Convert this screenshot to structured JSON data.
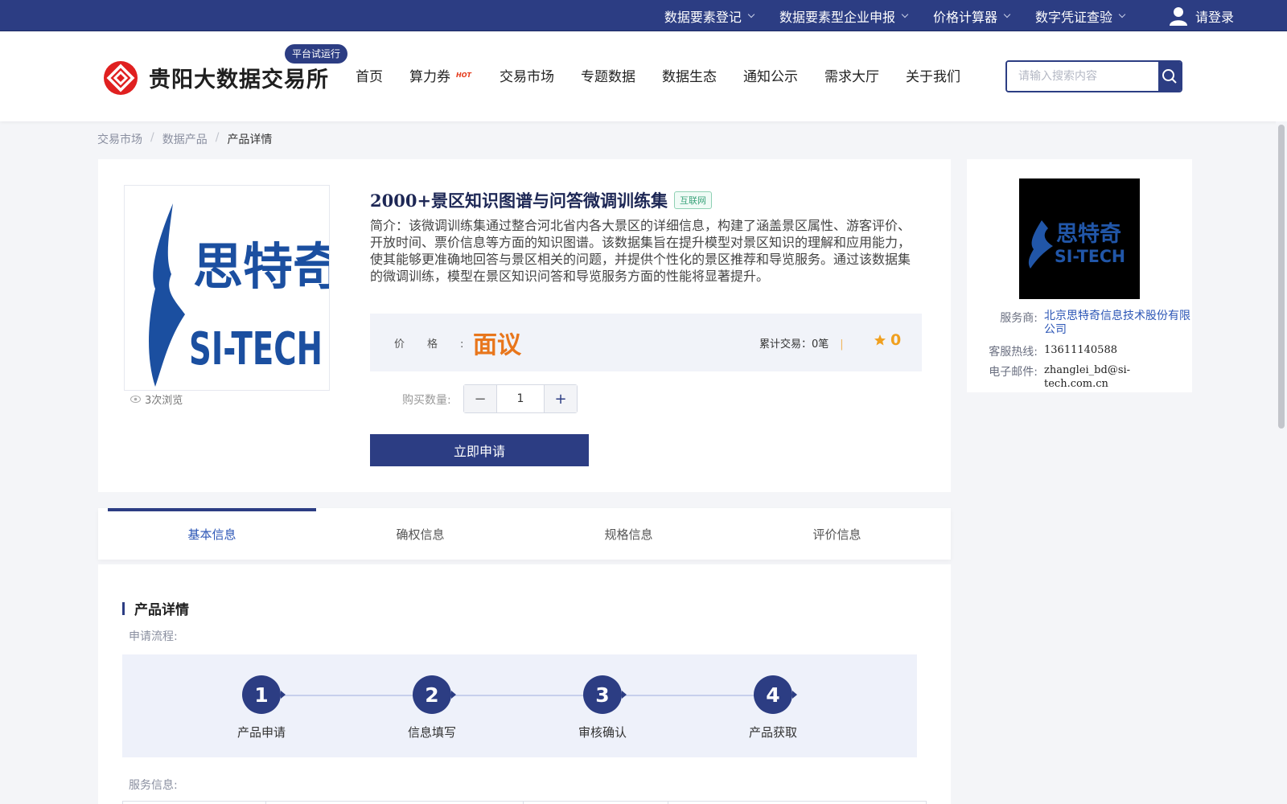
{
  "topbar": {
    "items": [
      {
        "label": "数据要素登记"
      },
      {
        "label": "数据要素型企业申报"
      },
      {
        "label": "价格计算器"
      },
      {
        "label": "数字凭证查验"
      }
    ],
    "login_label": "请登录"
  },
  "header": {
    "site_name": "贵阳大数据交易所",
    "badge": "平台试运行",
    "nav": [
      {
        "label": "首页"
      },
      {
        "label": "算力券",
        "tag": "HOT"
      },
      {
        "label": "交易市场"
      },
      {
        "label": "专题数据"
      },
      {
        "label": "数据生态"
      },
      {
        "label": "通知公示"
      },
      {
        "label": "需求大厅"
      },
      {
        "label": "关于我们"
      }
    ],
    "search_placeholder": "请输入搜索内容"
  },
  "breadcrumb": [
    "交易市场",
    "数据产品",
    "产品详情"
  ],
  "product": {
    "title": "2000+景区知识图谱与问答微调训练集",
    "tag": "互联网",
    "description": "简介：该微调训练集通过整合河北省内各大景区的详细信息，构建了涵盖景区属性、游客评价、开放时间、票价信息等方面的知识图谱。该数据集旨在提升模型对景区知识的理解和应用能力，使其能够更准确地回答与景区相关的问题，并提供个性化的景区推荐和导览服务。通过该数据集的微调训练，模型在景区知识问答和导览服务方面的性能将显著提升。",
    "image_text_cn": "思特奇",
    "image_text_en": "SI-TECH",
    "views": "3次浏览",
    "price_label": "价格:",
    "price": "面议",
    "deals_label": "累计交易：",
    "deals_value": "0笔",
    "rating": "0",
    "qty_label": "购买数量:",
    "qty_value": "1",
    "apply_label": "立即申请"
  },
  "vendor": {
    "logo_text_cn": "思特奇",
    "logo_text_en": "SI-TECH",
    "provider_label": "服务商:",
    "provider": "北京思特奇信息技术股份有限公司",
    "hotline_label": "客服热线:",
    "hotline": "13611140588",
    "email_label": "电子邮件:",
    "email": "zhanglei_bd@si-tech.com.cn"
  },
  "tabs": [
    {
      "label": "基本信息",
      "active": true
    },
    {
      "label": "确权信息"
    },
    {
      "label": "规格信息"
    },
    {
      "label": "评价信息"
    }
  ],
  "details": {
    "section_title": "产品详情",
    "process_label": "申请流程:",
    "steps": [
      {
        "num": "1",
        "label": "产品申请"
      },
      {
        "num": "2",
        "label": "信息填写"
      },
      {
        "num": "3",
        "label": "审核确认"
      },
      {
        "num": "4",
        "label": "产品获取"
      }
    ],
    "service_label": "服务信息:"
  },
  "colors": {
    "primary": "#2c3d83",
    "price": "#e8761c",
    "link": "#2c56b6",
    "logo_red": "#e02020"
  }
}
